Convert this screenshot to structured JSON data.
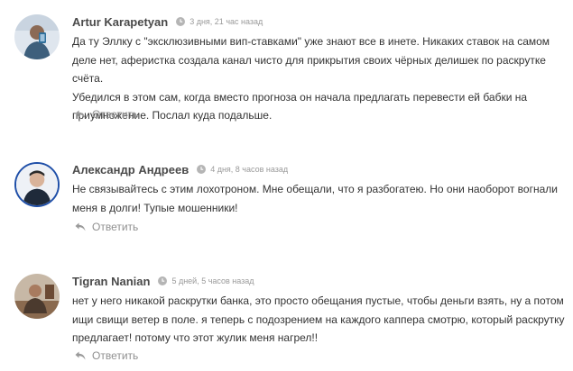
{
  "comments": [
    {
      "author": "Artur Karapetyan",
      "time": "3 дня, 21 час назад",
      "lines": [
        "Да ту Эллку с \"эксклюзивными вип-ставками\" уже знают все в инете. Никаких ставок на самом",
        "деле нет, аферистка создала канал чисто для прикрытия своих чёрных делишек по раскрутке счёта.",
        "Убедился в этом сам, когда вместо прогноза он начала предлагать перевести ей бабки на",
        "приумножение. Послал куда подальше."
      ],
      "reply": "Ответить",
      "avatar_icon": "person-with-phone-avatar",
      "accent": "#2f6f9a"
    },
    {
      "author": "Александр Андреев",
      "time": "4 дня, 8 часов назад",
      "lines": [
        "Не связывайтесь с этим лохотроном. Мне обещали, что я разбогатею. Но они наоборот вогнали",
        "меня в долги! Тупые мошенники!"
      ],
      "reply": "Ответить",
      "avatar_icon": "man-portrait-avatar",
      "accent": "#1f4fa8"
    },
    {
      "author": "Tigran Nanian",
      "time": "5 дней, 5 часов назад",
      "lines": [
        "нет у него никакой раскрутки банка, это просто обещания пустые, чтобы деньги взять, ну а потом",
        "ищи свищи ветер в поле. я теперь с подозрением на каждого каппера смотрю, который раскрутку",
        "предлагает! потому что этот жулик меня нагрел!!"
      ],
      "reply": "Ответить",
      "avatar_icon": "man-seated-avatar",
      "accent": "#6b4a34"
    }
  ]
}
